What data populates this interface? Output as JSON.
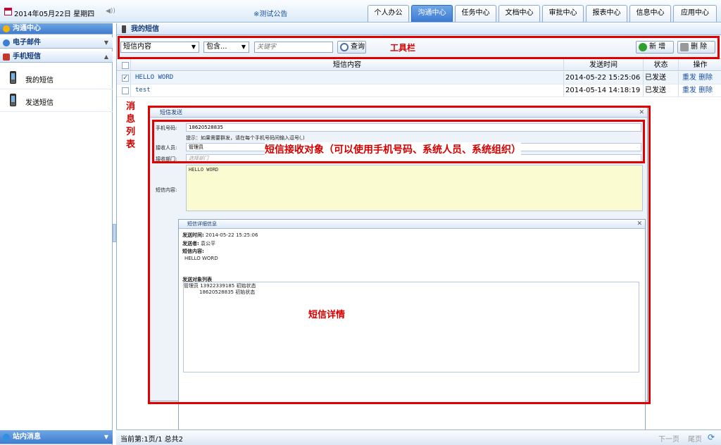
{
  "topbar": {
    "date": "2014年05月22日 星期四",
    "notice": "※测试公告",
    "tabs": [
      "个人办公",
      "沟通中心",
      "任务中心",
      "文档中心",
      "审批中心",
      "报表中心",
      "信息中心",
      "应用中心"
    ],
    "active_tab": "沟通中心"
  },
  "sidebar": {
    "header": "沟通中心",
    "sections": [
      {
        "label": "电子邮件"
      },
      {
        "label": "手机短信"
      }
    ],
    "items": [
      {
        "label": "我的短信",
        "icon": "phone-icon"
      },
      {
        "label": "发送短信",
        "icon": "phone-icon"
      }
    ],
    "footer": "站内消息"
  },
  "main": {
    "title": "我的短信",
    "toolbar": {
      "field_select": "短信内容",
      "op_select": "包含...",
      "keyword_placeholder": "关键字",
      "search_label": "查询",
      "new_label": "新 增",
      "delete_label": "删 除",
      "annotation": "工具栏"
    },
    "table": {
      "headers": [
        "短信内容",
        "发送时间",
        "状态",
        "操作"
      ],
      "rows": [
        {
          "content": "HELLO WORD",
          "time": "2014-05-22 15:25:06",
          "status": "已发送",
          "checked": true
        },
        {
          "content": "test",
          "time": "2014-05-14 14:18:19",
          "status": "已发送",
          "checked": false
        }
      ],
      "action_resend": "重发",
      "action_delete": "删除"
    },
    "list_annotation": "消息列表",
    "footer": {
      "paging": "当前第:1页/1 总共2",
      "next_label": "下一页",
      "last_label": "尾页"
    }
  },
  "send_dialog": {
    "title": "短信发送",
    "phone_label": "手机号码:",
    "phone_value": "18620528835",
    "hint": "提示：如果需要群发，请在每个手机号码间输入逗号(,)",
    "receiver_label": "接收人员:",
    "receiver_value": "管理员",
    "dept_label": "接收部门:",
    "dept_placeholder": "选择部门",
    "content_label": "短信内容:",
    "content_value": "HELLO WORD",
    "annotation": "短信接收对象（可以使用手机号码、系统人员、系统组织）"
  },
  "detail_dialog": {
    "title": "短信详细信息",
    "time_label": "发送时间:",
    "time_value": "2014-05-22 15:25:06",
    "sender_label": "发送者:",
    "sender_value": "袁公平",
    "content_label": "短信内容:",
    "content_value": "HELLO WORD",
    "recipients_label": "发送对象列表",
    "recipient_1": "管理员 13922339185 初始状态",
    "recipient_2": "18620528835 初始状态",
    "annotation": "短信详情"
  },
  "colors": {
    "accent": "#3b7ad2",
    "annotation": "#e00000",
    "link": "#1a4fa0"
  }
}
